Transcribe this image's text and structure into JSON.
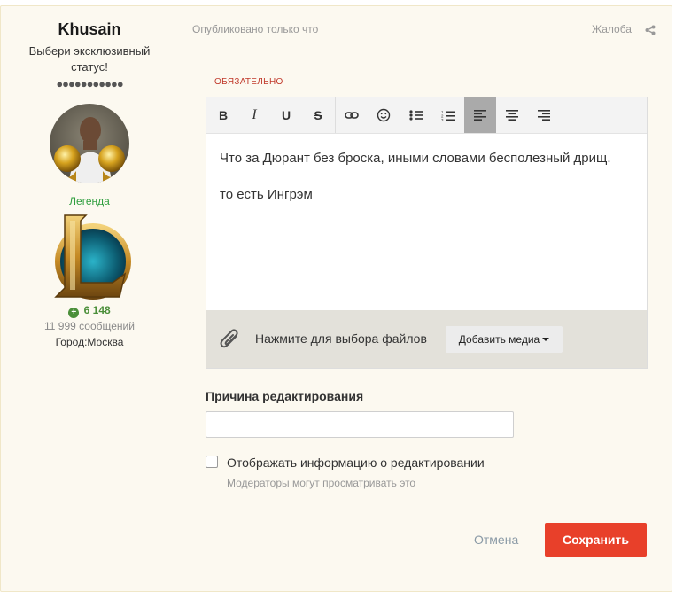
{
  "author": {
    "name": "Khusain",
    "status": "Выбери эксклюзивный статус!",
    "dots": "●●●●●●●●●●●",
    "rank": "Легенда",
    "reputation": "6 148",
    "posts": "11 999 сообщений",
    "city": "Город:Москва"
  },
  "post": {
    "published": "Опубликовано только что",
    "report": "Жалоба"
  },
  "editor": {
    "required": "ОБЯЗАТЕЛЬНО",
    "paragraphs": [
      "Что за Дюрант без броска, иными словами бесполезный дрищ.",
      "то есть Ингрэм"
    ],
    "toolbar": {
      "bold": "B",
      "italic": "I",
      "underline": "U",
      "strike": "S"
    },
    "attach_text": "Нажмите для выбора файлов",
    "media_button": "Добавить медиа"
  },
  "edit_reason": {
    "label": "Причина редактирования",
    "value": ""
  },
  "show_edit": {
    "label": "Отображать информацию о редактировании",
    "hint": "Модераторы могут просматривать это",
    "checked": false
  },
  "actions": {
    "cancel": "Отмена",
    "save": "Сохранить"
  },
  "colors": {
    "accent": "#e8402a",
    "rank": "#2e9e3e",
    "reputation": "#4b8f3a",
    "required": "#c0392b"
  }
}
